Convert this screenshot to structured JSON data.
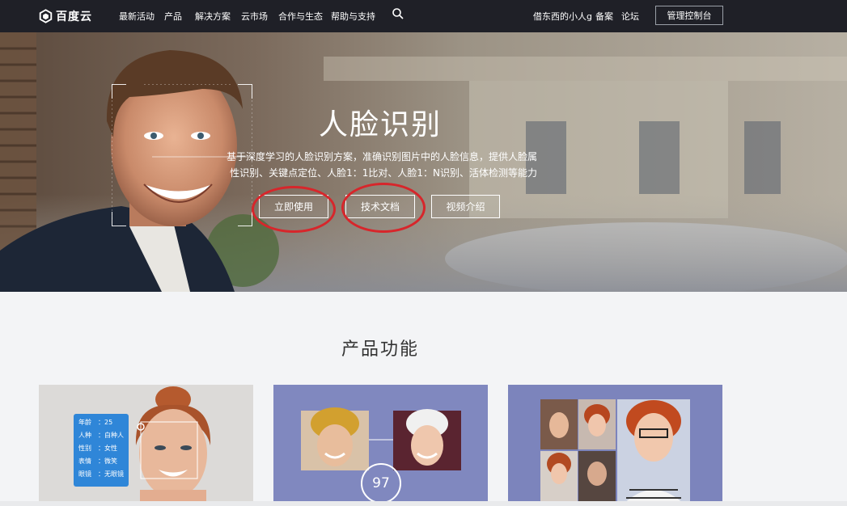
{
  "nav": {
    "brand": "百度云",
    "items": [
      "最新活动",
      "产品",
      "解决方案",
      "云市场",
      "合作与生态",
      "帮助与支持"
    ],
    "user": "借东西的小人g",
    "record": "备案",
    "forum": "论坛",
    "console": "管理控制台",
    "search_icon": "search-icon"
  },
  "hero": {
    "title": "人脸识别",
    "desc_line1": "基于深度学习的人脸识别方案，准确识别图片中的人脸信息，提供人脸属",
    "desc_line2": "性识别、关键点定位、人脸1：1比对、人脸1：N识别、活体检测等能力",
    "buttons": [
      "立即使用",
      "技术文档",
      "视频介绍"
    ]
  },
  "products": {
    "title": "产品功能",
    "card1": {
      "attrs": [
        {
          "k": "年龄",
          "v": "：25"
        },
        {
          "k": "人种",
          "v": "：白种人"
        },
        {
          "k": "性别",
          "v": "：女性"
        },
        {
          "k": "表情",
          "v": "：微笑"
        },
        {
          "k": "眼镜",
          "v": "：无眼镜"
        }
      ]
    },
    "card2": {
      "score": "97"
    }
  },
  "colors": {
    "nav_bg": "#1f2027",
    "accent_red": "#d7262b",
    "attr_blue": "#2f86d8"
  }
}
